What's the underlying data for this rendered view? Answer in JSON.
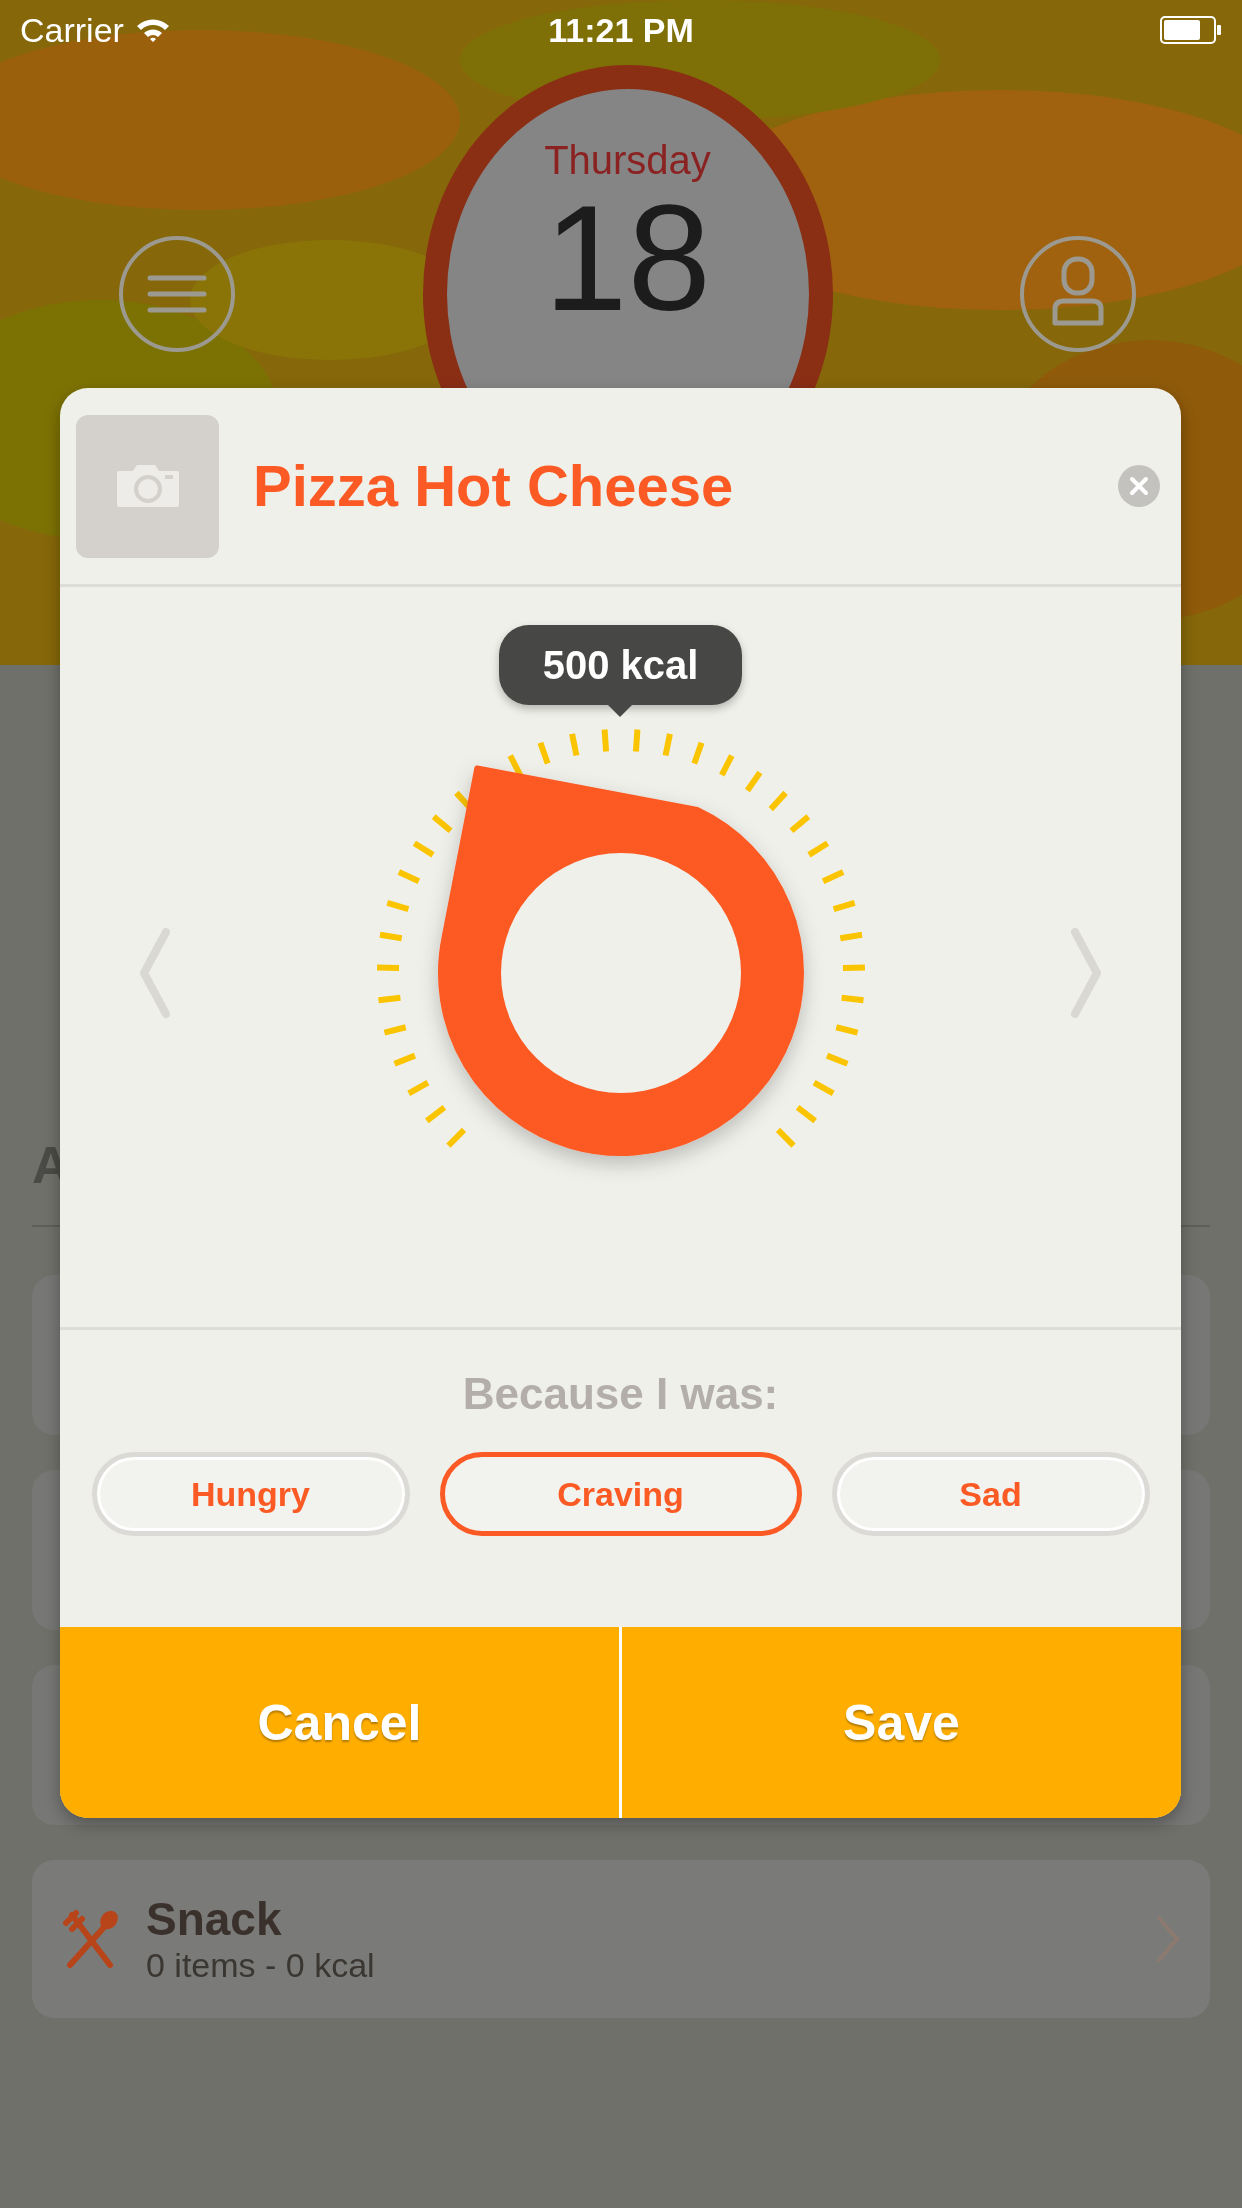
{
  "status_bar": {
    "carrier": "Carrier",
    "time": "11:21 PM"
  },
  "header": {
    "day_name": "Thursday",
    "day": "18"
  },
  "background": {
    "section_heading": "A",
    "snack": {
      "name": "Snack",
      "summary": "0 items - 0 kcal"
    }
  },
  "dialog": {
    "title": "Pizza Hot Cheese",
    "calories": "500 kcal",
    "reason_prompt": "Because I was:",
    "reasons": [
      {
        "label": "Hungry",
        "selected": false
      },
      {
        "label": "Craving",
        "selected": true
      },
      {
        "label": "Sad",
        "selected": false
      }
    ],
    "buttons": [
      {
        "label": "Cancel"
      },
      {
        "label": "Save"
      }
    ]
  }
}
